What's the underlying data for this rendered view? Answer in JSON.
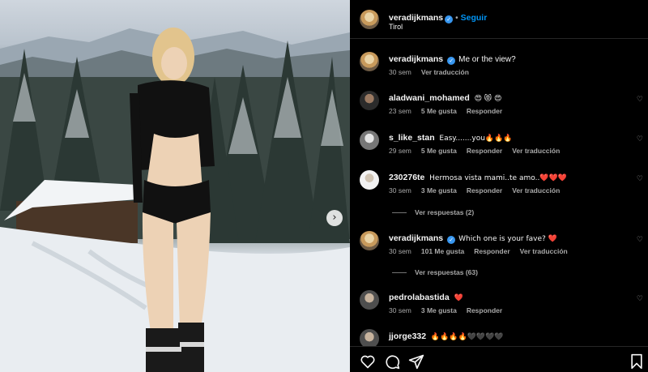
{
  "post": {
    "author": "veradijkmans",
    "follow_label": "Seguir",
    "separator": "•",
    "location": "Tirol"
  },
  "caption": {
    "username": "veradijkmans",
    "text": "Me or the view?",
    "time": "30 sem",
    "translate": "Ver traducción"
  },
  "comments": [
    {
      "username": "aladwani_mohamed",
      "text": "😍 😻 😍",
      "time": "23 sem",
      "likes": "5 Me gusta",
      "reply": "Responder",
      "translate": ""
    },
    {
      "username": "s_like_stan",
      "text": "Easy.......you🔥🔥🔥",
      "time": "29 sem",
      "likes": "5 Me gusta",
      "reply": "Responder",
      "translate": "Ver traducción"
    },
    {
      "username": "230276te",
      "text": "Hermosa vista mami..te amo..❤️❤️❤️",
      "time": "30 sem",
      "likes": "3 Me gusta",
      "reply": "Responder",
      "translate": "Ver traducción",
      "view_replies": "Ver respuestas (2)"
    },
    {
      "username": "veradijkmans",
      "text": "Which one is your fave? ❤️",
      "time": "30 sem",
      "likes": "101 Me gusta",
      "reply": "Responder",
      "translate": "Ver traducción",
      "view_replies": "Ver respuestas (63)"
    },
    {
      "username": "pedrolabastida",
      "text": "❤️",
      "time": "30 sem",
      "likes": "3 Me gusta",
      "reply": "Responder",
      "translate": ""
    },
    {
      "username": "jjorge332",
      "text": "🔥🔥🔥🔥🖤🖤🖤🖤",
      "time": "",
      "likes": "",
      "reply": "",
      "translate": ""
    }
  ],
  "icons": {
    "like": "heart-icon",
    "comment": "comment-icon",
    "share": "send-icon",
    "save": "bookmark-icon",
    "next": "chevron-right-icon"
  },
  "colors": {
    "follow": "#0095f6",
    "verified": "#3897f0",
    "heart": "#ed4956",
    "fire": "#ff8a1f"
  }
}
